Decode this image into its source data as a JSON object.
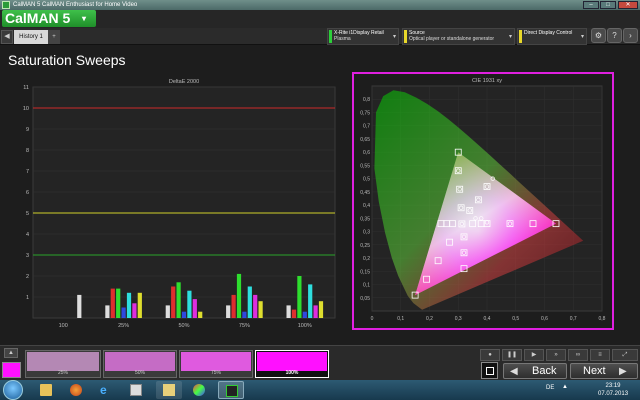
{
  "window": {
    "title": "CalMAN 5 CalMAN Enthusiast for Home Video",
    "minimize": "–",
    "maximize": "□",
    "close": "✕"
  },
  "app": {
    "logo_text": "CalMAN 5",
    "logo_caret": "▾"
  },
  "tabs": {
    "back_arrow": "◀",
    "history_tab": "History 1",
    "add_tab": "+"
  },
  "devices": {
    "meter": {
      "line1": "X-Rite i1Display Retail",
      "line2": "Plasma",
      "color": "#2ccf3a"
    },
    "source": {
      "line1": "Source",
      "line2": "Optical player or standalone generator",
      "color": "#e8d82a"
    },
    "display": {
      "line1": "Direct Display Control",
      "line2": "",
      "color": "#e8d82a"
    }
  },
  "toolbar_icons": [
    "gear-icon",
    "help-icon",
    "next-arrow-icon"
  ],
  "page_title": "Saturation Sweeps",
  "chart_data": [
    {
      "type": "bar",
      "title": "DeltaE 2000",
      "ylim": [
        0,
        11
      ],
      "yticks": [
        1,
        2,
        3,
        4,
        5,
        6,
        7,
        8,
        9,
        10,
        11
      ],
      "reference_lines": [
        {
          "y": 10,
          "color": "#cc2a2a"
        },
        {
          "y": 5,
          "color": "#cfcf2a"
        },
        {
          "y": 3,
          "color": "#2aa52a"
        }
      ],
      "categories": [
        "100",
        "25%",
        "50%",
        "75%",
        "100%"
      ],
      "series": [
        {
          "color": "#ffffff",
          "values": [
            1.1,
            0.6,
            0.6,
            0.6,
            0.6
          ]
        },
        {
          "color": "#ff3030",
          "values": [
            null,
            1.4,
            1.5,
            1.1,
            0.4
          ]
        },
        {
          "color": "#30ff30",
          "values": [
            null,
            1.4,
            1.7,
            2.1,
            2.0
          ]
        },
        {
          "color": "#3050ff",
          "values": [
            null,
            0.5,
            0.3,
            0.3,
            0.3
          ]
        },
        {
          "color": "#30ffff",
          "values": [
            null,
            1.2,
            1.3,
            1.5,
            1.6
          ]
        },
        {
          "color": "#ff30ff",
          "values": [
            null,
            0.7,
            0.9,
            1.1,
            0.6
          ]
        },
        {
          "color": "#ffff30",
          "values": [
            null,
            1.2,
            0.3,
            0.8,
            0.8
          ]
        }
      ]
    },
    {
      "type": "scatter",
      "title": "CIE 1931 xy",
      "xlim": [
        0,
        0.8
      ],
      "ylim": [
        0,
        0.85
      ],
      "xticks": [
        "0",
        "0,1",
        "0,2",
        "0,3",
        "0,4",
        "0,5",
        "0,6",
        "0,7",
        "0,8"
      ],
      "yticks": [
        "0,05",
        "0,1",
        "0,15",
        "0,2",
        "0,25",
        "0,3",
        "0,35",
        "0,4",
        "0,45",
        "0,5",
        "0,55",
        "0,6",
        "0,65",
        "0,7",
        "0,75",
        "0,8"
      ],
      "gamut": {
        "red": [
          0.64,
          0.33
        ],
        "green": [
          0.3,
          0.6
        ],
        "blue": [
          0.15,
          0.06
        ],
        "white": [
          0.3127,
          0.329
        ]
      },
      "targets": [
        [
          0.3127,
          0.329
        ],
        [
          0.4,
          0.33
        ],
        [
          0.48,
          0.33
        ],
        [
          0.56,
          0.33
        ],
        [
          0.64,
          0.33
        ],
        [
          0.31,
          0.39
        ],
        [
          0.305,
          0.46
        ],
        [
          0.3,
          0.53
        ],
        [
          0.3,
          0.6
        ],
        [
          0.27,
          0.26
        ],
        [
          0.23,
          0.19
        ],
        [
          0.19,
          0.12
        ],
        [
          0.15,
          0.06
        ],
        [
          0.32,
          0.28
        ],
        [
          0.32,
          0.22
        ],
        [
          0.32,
          0.16
        ],
        [
          0.34,
          0.38
        ],
        [
          0.37,
          0.42
        ],
        [
          0.4,
          0.47
        ],
        [
          0.28,
          0.33
        ],
        [
          0.26,
          0.33
        ],
        [
          0.24,
          0.33
        ],
        [
          0.35,
          0.33
        ],
        [
          0.38,
          0.33
        ]
      ],
      "measured": [
        [
          0.3127,
          0.329
        ],
        [
          0.4,
          0.335
        ],
        [
          0.48,
          0.33
        ],
        [
          0.31,
          0.39
        ],
        [
          0.305,
          0.46
        ],
        [
          0.3,
          0.53
        ],
        [
          0.32,
          0.28
        ],
        [
          0.32,
          0.22
        ],
        [
          0.34,
          0.38
        ],
        [
          0.37,
          0.42
        ],
        [
          0.4,
          0.47
        ],
        [
          0.42,
          0.5
        ],
        [
          0.36,
          0.35
        ],
        [
          0.38,
          0.35
        ]
      ]
    }
  ],
  "bottom": {
    "steps": [
      "25%",
      "50%",
      "75%",
      "100%"
    ],
    "step_colors": [
      "#b488b4",
      "#c56cc5",
      "#df5adf",
      "#ff10ff"
    ],
    "main_swatch_color": "#ff10ff",
    "tool_icons": [
      "record-icon",
      "pause-icon",
      "play-icon",
      "fast-forward-icon",
      "loop-icon",
      "settings-icon",
      "expand-icon"
    ],
    "back_label": "Back",
    "next_label": "Next",
    "back_arrow": "◀",
    "next_arrow": "▶"
  },
  "taskbar": {
    "icons": [
      "windows-start-icon",
      "folder-icon",
      "firefox-icon",
      "internet-explorer-icon",
      "files-icon",
      "paint-icon",
      "calman-icon"
    ],
    "language": "DE",
    "tray_arrow": "▲",
    "time": "23:19",
    "date": "07.07.2013"
  }
}
